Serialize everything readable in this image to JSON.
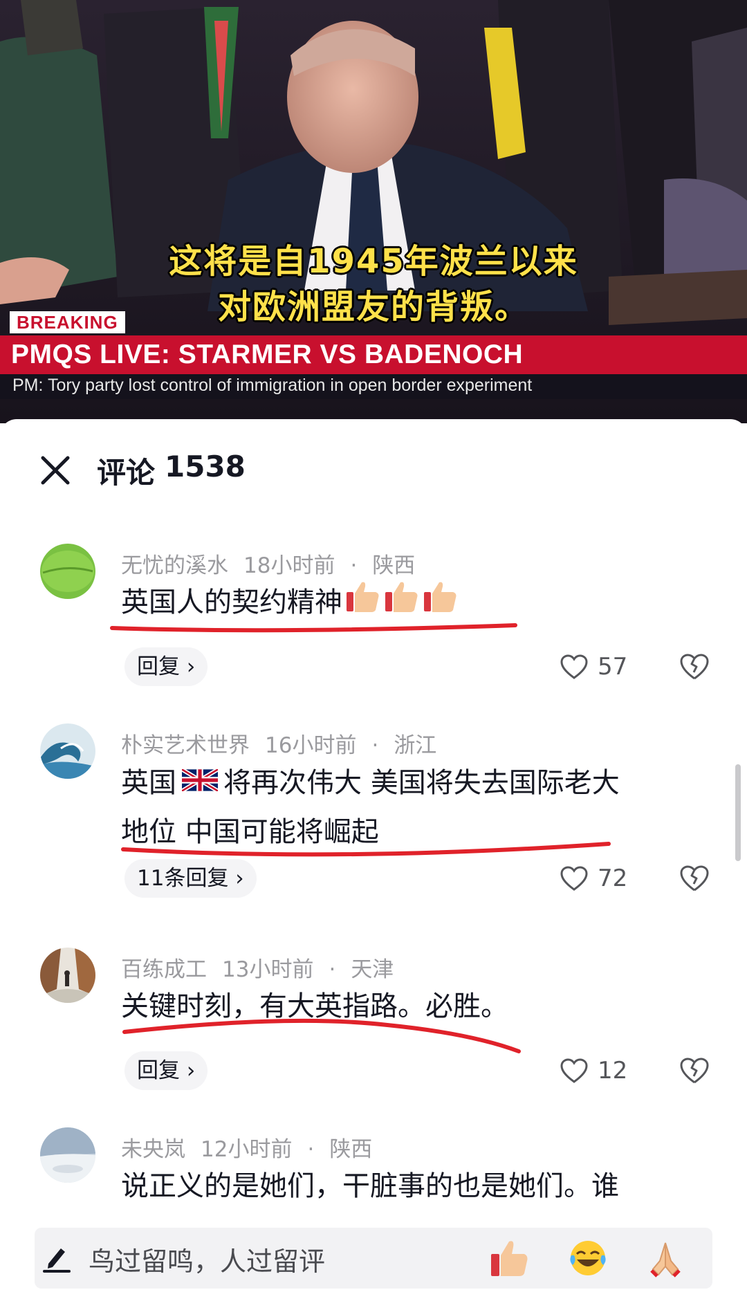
{
  "video": {
    "subtitle_line1": "这将是自1945年波兰以来",
    "subtitle_line2": "对欧洲盟友的背叛。",
    "breaking_label": "BREAKING",
    "headline": "PMQS LIVE: STARMER VS BADENOCH",
    "ticker": "PM: Tory party lost control of immigration in open border experiment",
    "colors": {
      "banner_red": "#c8102e",
      "subtitle_yellow": "#ffe14a"
    }
  },
  "comments_header": {
    "close_icon": "close-icon",
    "title": "评论",
    "count": "1538"
  },
  "comments": [
    {
      "username": "无忧的溪水",
      "time": "18小时前",
      "location": "陕西",
      "text": "英国人的契约精神",
      "emojis": [
        "thumbs-up-icon",
        "thumbs-up-icon",
        "thumbs-up-icon"
      ],
      "reply_label": "回复 ›",
      "likes": "57"
    },
    {
      "username": "朴实艺术世界",
      "time": "16小时前",
      "location": "浙江",
      "text_before_flag": "英国",
      "flag_icon": "uk-flag-icon",
      "text_line1_after_flag": "将再次伟大 美国将失去国际老大",
      "text_line2": "地位 中国可能将崛起",
      "reply_label": "11条回复 ›",
      "likes": "72"
    },
    {
      "username": "百练成工",
      "time": "13小时前",
      "location": "天津",
      "text": "关键时刻，有大英指路。必胜。",
      "reply_label": "回复 ›",
      "likes": "12"
    },
    {
      "username": "未央岚",
      "time": "12小时前",
      "location": "陕西",
      "text": "说正义的是她们，干脏事的也是她们。谁"
    }
  ],
  "input": {
    "placeholder": "鸟过留鸣，人过留评",
    "quick_emojis": [
      "thumbs-up-icon",
      "laughing-crying-icon",
      "praying-hands-icon"
    ]
  },
  "meta_separator": "·"
}
